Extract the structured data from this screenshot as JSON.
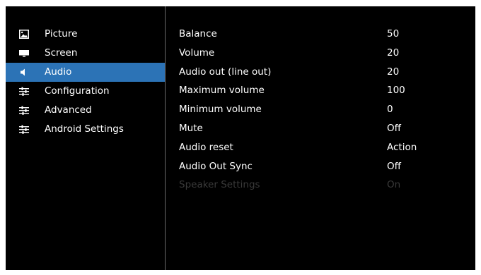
{
  "colors": {
    "background": "#000000",
    "selected_highlight": "#2c73b6",
    "text": "#ffffff",
    "disabled_text": "#3a3a3a"
  },
  "menu": {
    "items": [
      {
        "label": "Picture",
        "icon": "picture-icon",
        "selected": false
      },
      {
        "label": "Screen",
        "icon": "screen-icon",
        "selected": false
      },
      {
        "label": "Audio",
        "icon": "speaker-icon",
        "selected": true
      },
      {
        "label": "Configuration",
        "icon": "sliders-icon",
        "selected": false
      },
      {
        "label": "Advanced",
        "icon": "sliders-icon",
        "selected": false
      },
      {
        "label": "Android Settings",
        "icon": "sliders-icon",
        "selected": false
      }
    ]
  },
  "settings": {
    "rows": [
      {
        "name": "Balance",
        "value": "50",
        "enabled": true
      },
      {
        "name": "Volume",
        "value": "20",
        "enabled": true
      },
      {
        "name": "Audio out (line out)",
        "value": "20",
        "enabled": true
      },
      {
        "name": "Maximum volume",
        "value": "100",
        "enabled": true
      },
      {
        "name": "Minimum volume",
        "value": "0",
        "enabled": true
      },
      {
        "name": "Mute",
        "value": "Off",
        "enabled": true
      },
      {
        "name": "Audio reset",
        "value": "Action",
        "enabled": true
      },
      {
        "name": "Audio Out Sync",
        "value": "Off",
        "enabled": true
      },
      {
        "name": "Speaker Settings",
        "value": "On",
        "enabled": false
      }
    ]
  }
}
